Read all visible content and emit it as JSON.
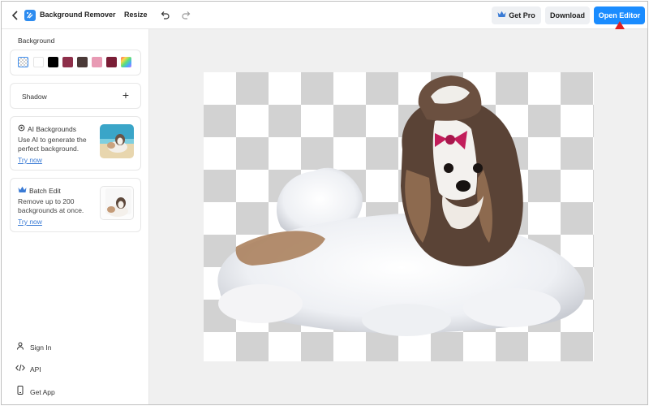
{
  "header": {
    "title": "Background Remover",
    "resize_label": "Resize",
    "get_pro_label": "Get Pro",
    "download_label": "Download",
    "open_editor_label": "Open Editor"
  },
  "sidebar": {
    "background_label": "Background",
    "swatches": [
      "transparent",
      "#ffffff",
      "#000000",
      "#8e2f4a",
      "#4b3a38",
      "#e89ab4",
      "#7a1d36",
      "rainbow-gradient"
    ],
    "shadow_label": "Shadow",
    "ai_card": {
      "title": "AI Backgrounds",
      "description": "Use AI to generate the perfect background.",
      "link": "Try now"
    },
    "batch_card": {
      "title": "Batch Edit",
      "description": "Remove up to 200 backgrounds at once.",
      "link": "Try now"
    },
    "footer": {
      "sign_in": "Sign In",
      "api": "API",
      "get_app": "Get App"
    }
  },
  "colors": {
    "accent": "#1a8cff",
    "link": "#3a7bd5",
    "annotation_arrow": "#e02020"
  }
}
